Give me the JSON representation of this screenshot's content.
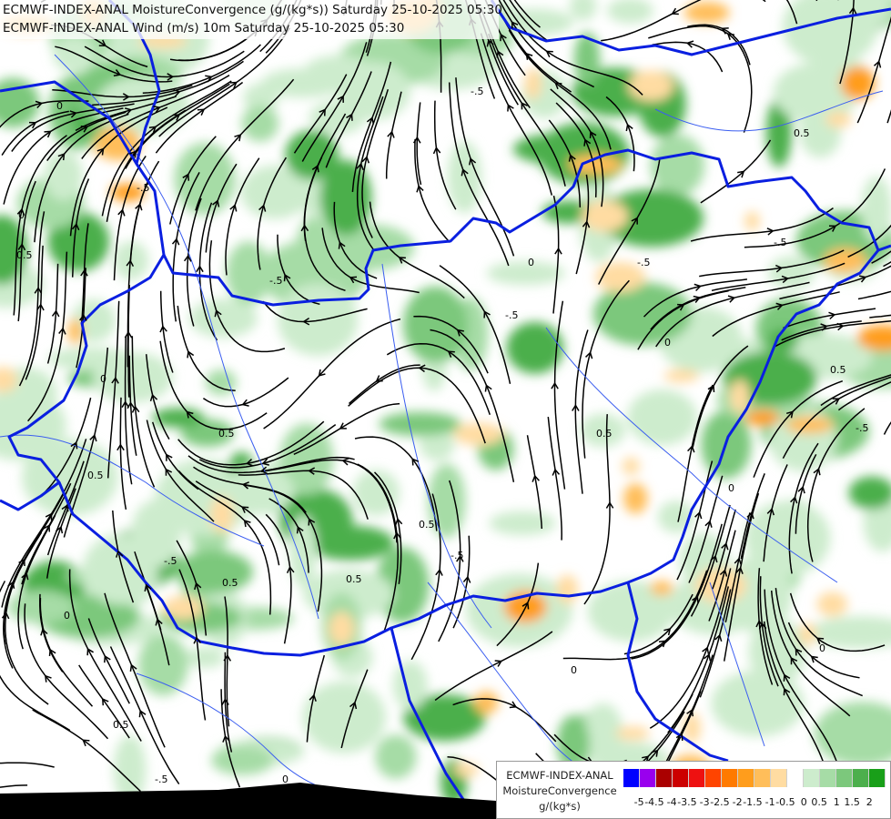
{
  "map": {
    "title_lines": [
      "ECMWF-INDEX-ANAL MoistureConvergence (g/(kg*s)) Saturday 25-10-2025 05:30",
      "ECMWF-INDEX-ANAL Wind (m/s) 10m Saturday 25-10-2025 05:30"
    ],
    "contour_labels": [
      "0",
      "0.5",
      "-.5"
    ],
    "colors": {
      "land_fill": "#ffffff",
      "border_line": "#0a1fe0",
      "river_line": "#3b5ef0",
      "streamline": "#000000",
      "bottom_strip": "#000000"
    }
  },
  "legend": {
    "title_lines": [
      "ECMWF-INDEX-ANAL",
      "MoistureConvergence",
      "g/(kg*s)"
    ],
    "colors": [
      "#0000ff",
      "#9900ee",
      "#aa0000",
      "#cc0000",
      "#ee1111",
      "#ff4400",
      "#ff7a00",
      "#ff9d1c",
      "#ffbe5a",
      "#ffdca2",
      "#ffffff",
      "#cdeccd",
      "#a6dca6",
      "#7cc87c",
      "#4caf4c",
      "#199f19"
    ],
    "tick_labels": [
      "-5",
      "-4.5",
      "-4",
      "-3.5",
      "-3",
      "-2.5",
      "-2",
      "-1.5",
      "-1",
      "-0.5",
      "0",
      "0.5",
      "1",
      "1.5",
      "2"
    ]
  }
}
